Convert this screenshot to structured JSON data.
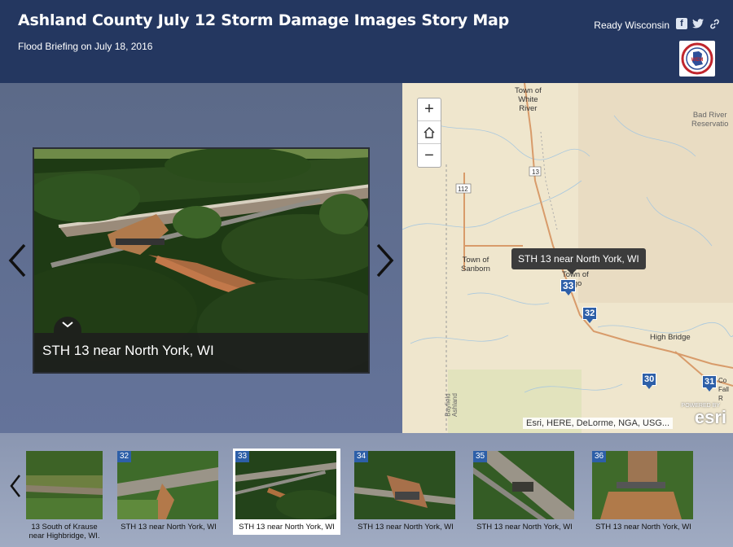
{
  "header": {
    "title": "Ashland County July 12 Storm Damage Images Story Map",
    "subtitle": "Flood Briefing on July 18, 2016",
    "brand": "Ready Wisconsin",
    "logo_text": "WEM"
  },
  "photo": {
    "caption": "STH 13 near North York, WI"
  },
  "map": {
    "tooltip": "STH 13 near North York, WI",
    "labels": {
      "white_river": "Town of\nWhite\nRiver",
      "bad_river": "Bad River\nReservatio",
      "sanborn": "Town of\nSanborn",
      "mellengo": "Town of\nngo",
      "high_bridge": "High Bridge",
      "route_13": "13",
      "route_112": "112",
      "bayfield": "Bayfield",
      "ashland": "Ashland",
      "co": "Co\nFall\nR"
    },
    "markers": [
      "33",
      "32",
      "30",
      "31"
    ],
    "attribution": "Esri, HERE, DeLorme, NGA, USG...",
    "powered_by": "POWERED BY",
    "esri": "esri"
  },
  "thumbnails": [
    {
      "num": "",
      "label": "13 South of Krause\nnear Highbridge, WI."
    },
    {
      "num": "32",
      "label": "STH 13 near North York, WI"
    },
    {
      "num": "33",
      "label": "STH 13 near North York, WI"
    },
    {
      "num": "34",
      "label": "STH 13 near North York, WI"
    },
    {
      "num": "35",
      "label": "STH 13 near North York, WI"
    },
    {
      "num": "36",
      "label": "STH 13 near North York, WI"
    }
  ],
  "colors": {
    "header_bg": "#243760",
    "marker": "#2d5fa8"
  }
}
